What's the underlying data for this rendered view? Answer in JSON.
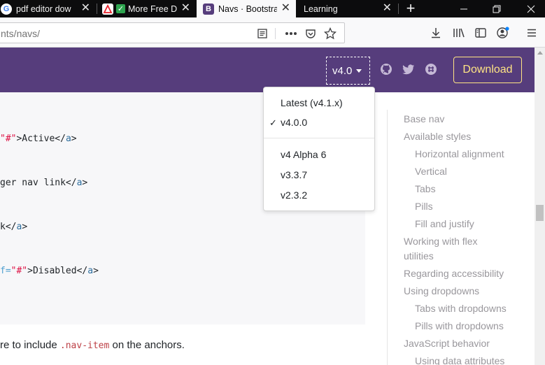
{
  "browser": {
    "tabs": [
      {
        "title": "pdf editor dow",
        "favicon": "G"
      },
      {
        "title": "More Free D",
        "favicon": "pdf"
      },
      {
        "title": "Navs · Bootstrap",
        "favicon": "B"
      },
      {
        "title": "Learning",
        "favicon": ""
      }
    ],
    "new_tab_label": "+",
    "url": "nts/navs/",
    "colors": {
      "tabbar": "#0c0c0d",
      "active_tab": "#f9f9fa"
    }
  },
  "site": {
    "version_label": "v4.0",
    "download_label": "Download",
    "colors": {
      "header": "#563d7c",
      "download": "#ffe484"
    }
  },
  "version_menu": {
    "items": [
      {
        "label": "Latest (v4.1.x)",
        "checked": false
      },
      {
        "label": "v4.0.0",
        "checked": true
      },
      {
        "label": "v4 Alpha 6",
        "checked": false
      },
      {
        "label": "v3.3.7",
        "checked": false
      },
      {
        "label": "v2.3.2",
        "checked": false
      }
    ],
    "check_mark": "✓"
  },
  "code": {
    "line1": {
      "pre": "\"#\"",
      "mid": ">Active</",
      "tag": "a",
      "end": ">"
    },
    "line2": {
      "pre": "ger nav link</",
      "tag": "a",
      "end": ">"
    },
    "line3": {
      "pre": "k</",
      "tag": "a",
      "end": ">"
    },
    "line4": {
      "attr": "f=",
      "str": "\"#\"",
      "mid": ">Disabled</",
      "tag": "a",
      "end": ">"
    }
  },
  "paragraph": {
    "before": "re to include ",
    "code": ".nav-item",
    "after": " on the anchors."
  },
  "toc": {
    "items": [
      {
        "label": "Base nav",
        "level": 0
      },
      {
        "label": "Available styles",
        "level": 0
      },
      {
        "label": "Horizontal alignment",
        "level": 1
      },
      {
        "label": "Vertical",
        "level": 1
      },
      {
        "label": "Tabs",
        "level": 1
      },
      {
        "label": "Pills",
        "level": 1
      },
      {
        "label": "Fill and justify",
        "level": 1
      },
      {
        "label": "Working with flex",
        "level": 0
      },
      {
        "label": "utilities",
        "level": 0
      },
      {
        "label": "Regarding accessibility",
        "level": 0
      },
      {
        "label": "Using dropdowns",
        "level": 0
      },
      {
        "label": "Tabs with dropdowns",
        "level": 1
      },
      {
        "label": "Pills with dropdowns",
        "level": 1
      },
      {
        "label": "JavaScript behavior",
        "level": 0
      },
      {
        "label": "Using data attributes",
        "level": 1
      }
    ]
  }
}
